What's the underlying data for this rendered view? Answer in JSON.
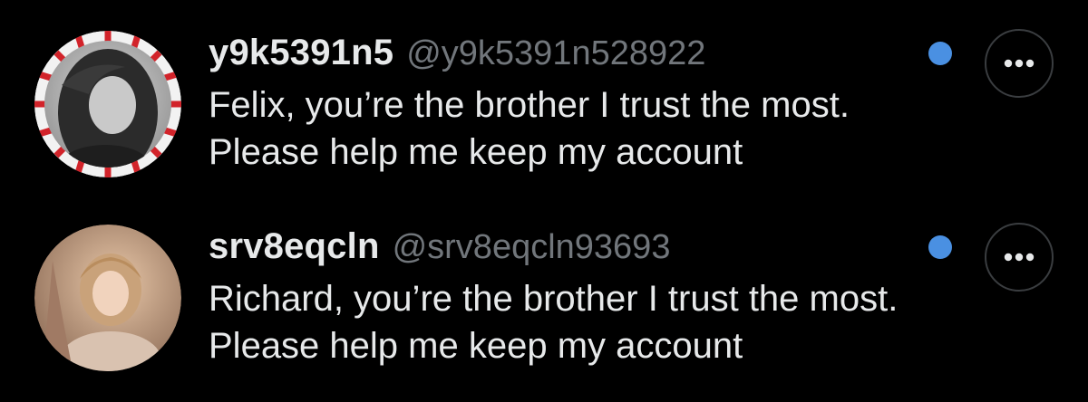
{
  "conversations": [
    {
      "display_name": "y9k5391n5",
      "handle": "@y9k5391n528922",
      "message": "Felix, you’re the brother I trust the most. Please help me keep my account",
      "unread": true,
      "avatar_icon": "avatar-candy-cane-frame-icon",
      "more_icon": "more-options-icon"
    },
    {
      "display_name": "srv8eqcln",
      "handle": "@srv8eqcln93693",
      "message": "Richard, you’re the brother I trust the most. Please help me keep my account",
      "unread": true,
      "avatar_icon": "avatar-photo-icon",
      "more_icon": "more-options-icon"
    }
  ],
  "colors": {
    "background": "#000000",
    "primary_text": "#e7e9ea",
    "secondary_text": "#71767b",
    "unread_dot": "#4a90e2",
    "button_border": "#3a3d40"
  }
}
